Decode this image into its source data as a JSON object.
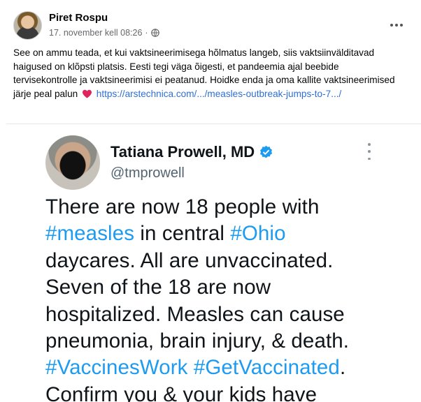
{
  "post": {
    "author": "Piret Rospu",
    "timestamp": "17. november kell 08:26",
    "separator": "·",
    "caption_text": "See on ammu teada, et kui vaktsineerimisega hõlmatus langeb, siis vaktsiinvälditavad haigused on klõpsti platsis. Eesti tegi väga õigesti, et pandeemia ajal beebide tervisekontrolle ja vaktsineerimisi ei peatanud. Hoidke enda ja oma kallite vaktsineerimised järje peal palun",
    "link_text": "https://arstechnica.com/.../measles-outbreak-jumps-to-7.../",
    "privacy_icon": "globe-icon",
    "emoji": "heart-icon",
    "heart_color": "#e0245e"
  },
  "tweet": {
    "name": "Tatiana Prowell, MD",
    "handle": "@tmprowell",
    "verified_color": "#1d9bf0",
    "hashtag_color": "#1d9bf0",
    "lines": [
      [
        {
          "t": "There are now 18 people with"
        }
      ],
      [
        {
          "t": "#measles",
          "h": true
        },
        {
          "t": " in central "
        },
        {
          "t": "#Ohio",
          "h": true
        }
      ],
      [
        {
          "t": "daycares. All are  unvaccinated."
        }
      ],
      [
        {
          "t": "Seven of the 18 are now"
        }
      ],
      [
        {
          "t": "hospitalized. Measles can cause"
        }
      ],
      [
        {
          "t": "pneumonia, brain injury, & death."
        }
      ],
      [
        {
          "t": "#VaccinesWork",
          "h": true
        },
        {
          "t": " "
        },
        {
          "t": "#GetVaccinated",
          "h": true
        },
        {
          "t": "."
        }
      ],
      [
        {
          "t": "Confirm you & your kids have"
        }
      ]
    ]
  }
}
